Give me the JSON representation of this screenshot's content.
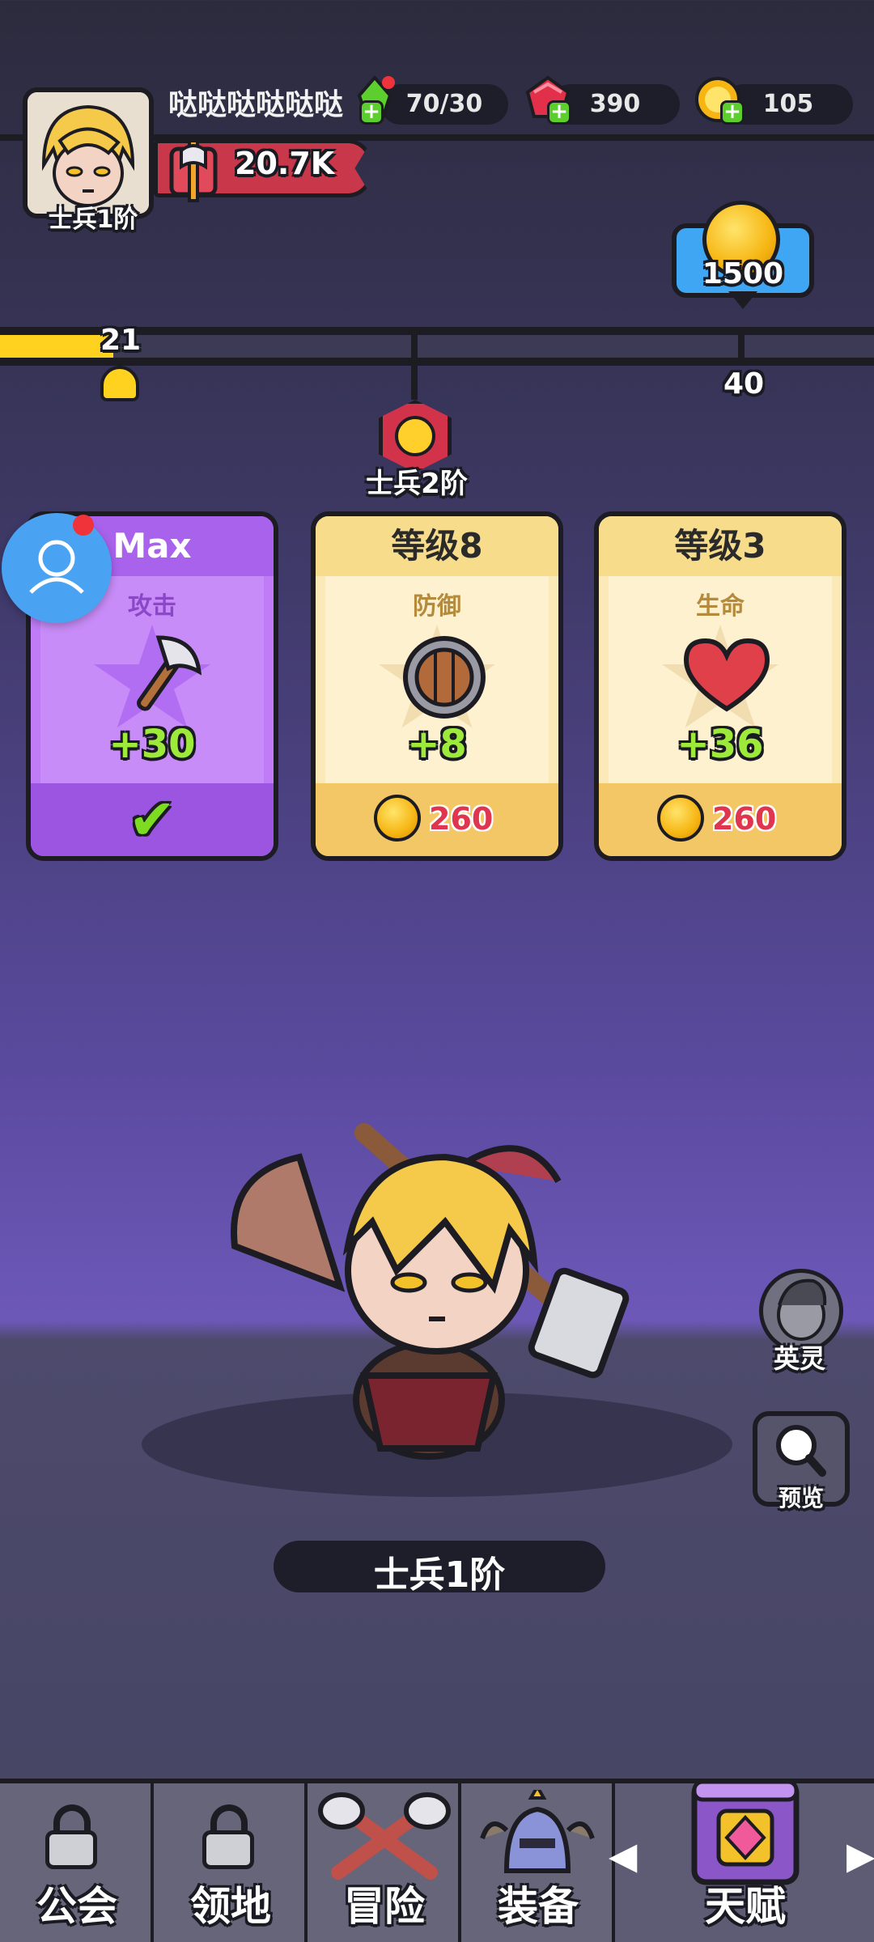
{
  "player": {
    "name": "哒哒哒哒哒哒",
    "avatar_rank": "士兵1阶",
    "power": "20.7K"
  },
  "resources": [
    {
      "name": "energy",
      "icon": "green-potion-icon",
      "value": "70/30"
    },
    {
      "name": "gems",
      "icon": "ruby-icon",
      "value": "390"
    },
    {
      "name": "coins",
      "icon": "gold-coin-icon",
      "value": "105"
    }
  ],
  "reward": {
    "amount": "1500",
    "icon": "gold-coin-icon"
  },
  "progress": {
    "current": "21",
    "next": "40",
    "fraction": 0.13,
    "milestone_label": "士兵2阶"
  },
  "cards": [
    {
      "header": "Max",
      "stat": "攻击",
      "icon": "axe-icon",
      "bonus": "+30",
      "state": "maxed",
      "check": "✔"
    },
    {
      "header": "等级8",
      "stat": "防御",
      "icon": "shield-icon",
      "bonus": "+8",
      "price": "260"
    },
    {
      "header": "等级3",
      "stat": "生命",
      "icon": "heart-icon",
      "bonus": "+36",
      "price": "260"
    }
  ],
  "hero": {
    "name": "士兵1阶"
  },
  "side_buttons": {
    "spirit": "英灵",
    "preview": "预览"
  },
  "nav": [
    {
      "label": "公会",
      "locked": true
    },
    {
      "label": "领地",
      "locked": true
    },
    {
      "label": "冒险",
      "locked": false
    },
    {
      "label": "装备",
      "locked": false
    },
    {
      "label": "天赋",
      "locked": false,
      "active": true
    }
  ],
  "colors": {
    "accent_yellow": "#ffd21f",
    "card_purple": "#c07cf7",
    "card_cream": "#fbe9b8",
    "bubble_blue": "#3ea6f2"
  }
}
